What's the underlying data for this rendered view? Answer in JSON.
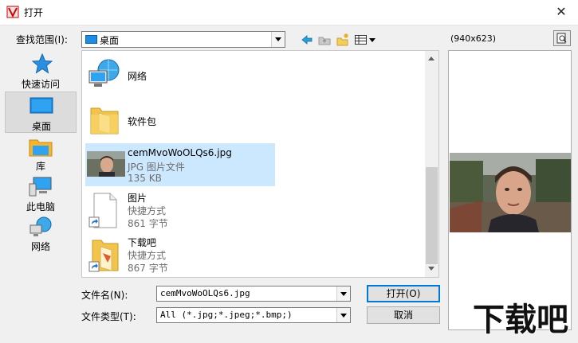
{
  "window": {
    "title": "打开",
    "close_symbol": "✕"
  },
  "toolbar": {
    "look_in_label": "查找范围(I):",
    "look_in_value": "桌面",
    "icons": [
      "back-arrow-icon",
      "up-folder-icon",
      "new-folder-icon",
      "view-menu-icon"
    ]
  },
  "sidebar": {
    "items": [
      {
        "label": "快速访问",
        "icon": "star-icon",
        "selected": false
      },
      {
        "label": "桌面",
        "icon": "desktop-icon",
        "selected": true
      },
      {
        "label": "库",
        "icon": "library-icon",
        "selected": false
      },
      {
        "label": "此电脑",
        "icon": "computer-icon",
        "selected": false
      },
      {
        "label": "网络",
        "icon": "network-icon",
        "selected": false
      }
    ]
  },
  "files": [
    {
      "name": "网络",
      "icon": "network-icon"
    },
    {
      "name": "软件包",
      "icon": "folder-icon"
    },
    {
      "name": "cemMvoWoOLQs6.jpg",
      "type": "JPG 图片文件",
      "size": "135 KB",
      "icon": "photo-thumbnail",
      "selected": true
    },
    {
      "name": "图片",
      "type": "快捷方式",
      "size": "861 字节",
      "icon": "shortcut-file-icon"
    },
    {
      "name": "下载吧",
      "type": "快捷方式",
      "size": "867 字节",
      "icon": "shortcut-folder-icon"
    }
  ],
  "form": {
    "filename_label": "文件名(N):",
    "filename_value": "cemMvoWoOLQs6.jpg",
    "filetype_label": "文件类型(T):",
    "filetype_value": "All (*.jpg;*.jpeg;*.bmp;)",
    "open_label": "打开(O)",
    "cancel_label": "取消"
  },
  "preview": {
    "dimensions": "(940x623)"
  },
  "watermark": {
    "text": "下载吧"
  },
  "colors": {
    "selection": "#cce8ff",
    "accent": "#0078d7"
  }
}
